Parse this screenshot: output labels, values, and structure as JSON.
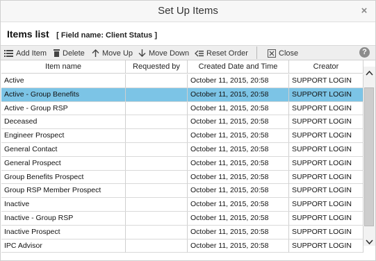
{
  "window": {
    "title": "Set Up Items",
    "close_symbol": "×",
    "close_icon": "close-x-icon"
  },
  "heading": {
    "title": "Items list",
    "field": "[ Field name: Client Status ]"
  },
  "toolbar": {
    "add_label": "Add Item",
    "delete_label": "Delete",
    "move_up_label": "Move Up",
    "move_down_label": "Move Down",
    "reset_label": "Reset Order",
    "close_label": "Close",
    "help_label": "?"
  },
  "table": {
    "columns": [
      "Item name",
      "Requested by",
      "Created Date and Time",
      "Creator"
    ],
    "selected_row": 1,
    "selected_color": "#7cc4e6",
    "rows": [
      {
        "name": "Active",
        "requested_by": "",
        "created": "October 11, 2015, 20:58",
        "creator": "SUPPORT LOGIN"
      },
      {
        "name": "Active - Group Benefits",
        "requested_by": "",
        "created": "October 11, 2015, 20:58",
        "creator": "SUPPORT LOGIN"
      },
      {
        "name": "Active - Group RSP",
        "requested_by": "",
        "created": "October 11, 2015, 20:58",
        "creator": "SUPPORT LOGIN"
      },
      {
        "name": "Deceased",
        "requested_by": "",
        "created": "October 11, 2015, 20:58",
        "creator": "SUPPORT LOGIN"
      },
      {
        "name": "Engineer Prospect",
        "requested_by": "",
        "created": "October 11, 2015, 20:58",
        "creator": "SUPPORT LOGIN"
      },
      {
        "name": "General Contact",
        "requested_by": "",
        "created": "October 11, 2015, 20:58",
        "creator": "SUPPORT LOGIN"
      },
      {
        "name": "General Prospect",
        "requested_by": "",
        "created": "October 11, 2015, 20:58",
        "creator": "SUPPORT LOGIN"
      },
      {
        "name": "Group Benefits Prospect",
        "requested_by": "",
        "created": "October 11, 2015, 20:58",
        "creator": "SUPPORT LOGIN"
      },
      {
        "name": "Group RSP Member Prospect",
        "requested_by": "",
        "created": "October 11, 2015, 20:58",
        "creator": "SUPPORT LOGIN"
      },
      {
        "name": "Inactive",
        "requested_by": "",
        "created": "October 11, 2015, 20:58",
        "creator": "SUPPORT LOGIN"
      },
      {
        "name": "Inactive - Group RSP",
        "requested_by": "",
        "created": "October 11, 2015, 20:58",
        "creator": "SUPPORT LOGIN"
      },
      {
        "name": "Inactive Prospect",
        "requested_by": "",
        "created": "October 11, 2015, 20:58",
        "creator": "SUPPORT LOGIN"
      },
      {
        "name": "IPC Advisor",
        "requested_by": "",
        "created": "October 11, 2015, 20:58",
        "creator": "SUPPORT LOGIN"
      }
    ]
  }
}
